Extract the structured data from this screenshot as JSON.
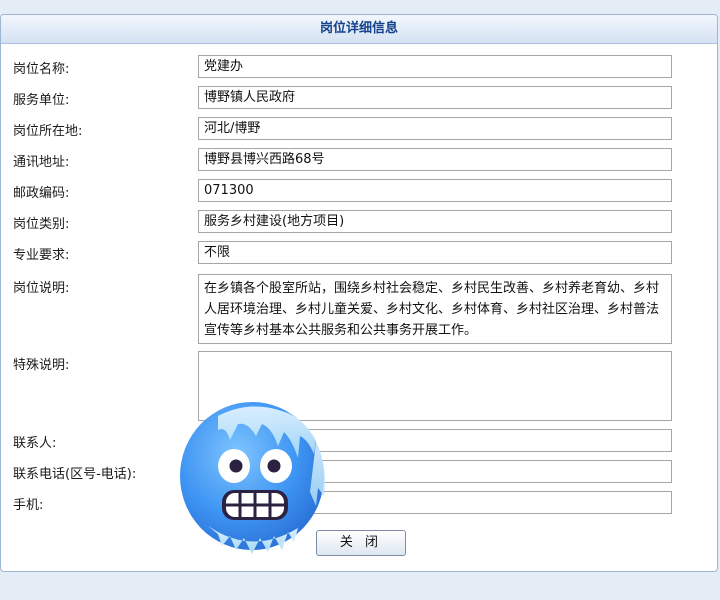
{
  "panel": {
    "title": "岗位详细信息"
  },
  "fields": {
    "position_name": {
      "label": "岗位名称:",
      "value": "党建办"
    },
    "service_unit": {
      "label": "服务单位:",
      "value": "博野镇人民政府"
    },
    "location": {
      "label": "岗位所在地:",
      "value": "河北/博野"
    },
    "address": {
      "label": "通讯地址:",
      "value": "博野县博兴西路68号"
    },
    "postcode": {
      "label": "邮政编码:",
      "value": "071300"
    },
    "category": {
      "label": "岗位类别:",
      "value": "服务乡村建设(地方项目)"
    },
    "major": {
      "label": "专业要求:",
      "value": "不限"
    },
    "description": {
      "label": "岗位说明:",
      "value": "在乡镇各个股室所站，围绕乡村社会稳定、乡村民生改善、乡村养老育幼、乡村人居环境治理、乡村儿童关爱、乡村文化、乡村体育、乡村社区治理、乡村普法宣传等乡村基本公共服务和公共事务开展工作。"
    },
    "special": {
      "label": "特殊说明:",
      "value": ""
    },
    "contact": {
      "label": "联系人:",
      "value": ""
    },
    "phone": {
      "label": "联系电话(区号-电话):",
      "value": ""
    },
    "mobile": {
      "label": "手机:",
      "value": ""
    }
  },
  "buttons": {
    "close_label": "关 闭"
  },
  "overlay": {
    "sticker_icon": "freezing-face-emoji-icon"
  }
}
